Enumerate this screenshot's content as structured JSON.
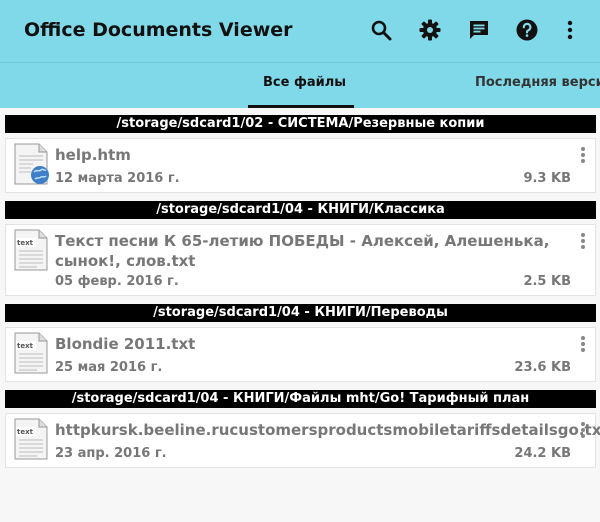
{
  "appbar": {
    "title": "Office Documents Viewer",
    "icons": [
      "search-icon",
      "gear-icon",
      "message-icon",
      "help-icon",
      "more-vert-icon"
    ]
  },
  "tabs": [
    {
      "label": "Все файлы",
      "selected": true
    },
    {
      "label": "Последняя версия",
      "selected": false
    }
  ],
  "colors": {
    "accent": "#7fd9e8",
    "indicator": "#111111",
    "folder_bg": "#000000"
  },
  "groups": [
    {
      "folder": "/storage/sdcard1/02  -  СИСТЕМА/Резервные копии",
      "file": {
        "name": "help.htm",
        "date": "12 марта 2016 г.",
        "size": "9.3 KB",
        "icon": "html-file-icon"
      }
    },
    {
      "folder": "/storage/sdcard1/04  -  КНИГИ/Классика",
      "file": {
        "name": "Текст песни К 65-летию ПОБЕДЫ - Алексей, Алешенька, сынок!, слов.txt",
        "date": "05 февр. 2016 г.",
        "size": "2.5 KB",
        "icon": "text-file-icon"
      }
    },
    {
      "folder": "/storage/sdcard1/04  -  КНИГИ/Переводы",
      "file": {
        "name": "Blondie 2011.txt",
        "date": "25 мая 2016 г.",
        "size": "23.6 KB",
        "icon": "text-file-icon"
      }
    },
    {
      "folder": "/storage/sdcard1/04  -  КНИГИ/Файлы  mht/Go! Тарифный план",
      "file": {
        "name": "httpkursk.beeline.rucustomersproductsmobiletariffsdetailsgo.txt",
        "date": "23 апр. 2016 г.",
        "size": "24.2 KB",
        "icon": "text-file-icon"
      }
    }
  ]
}
